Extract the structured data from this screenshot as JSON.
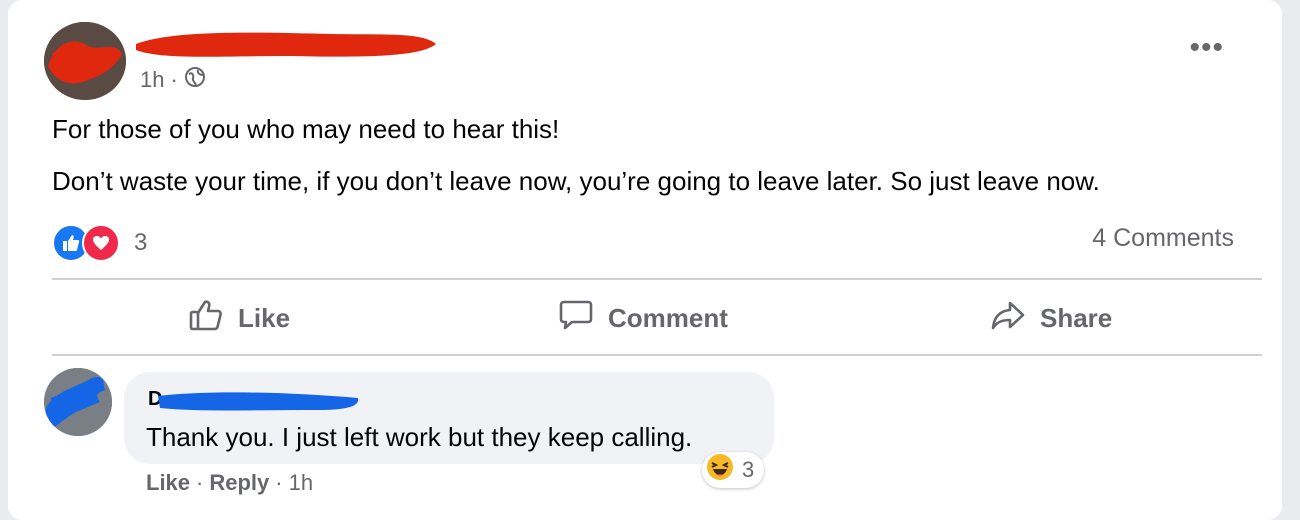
{
  "post": {
    "author_initial_visible": "",
    "time": "1h",
    "separator": "·",
    "audience_icon": "globe-icon",
    "more_icon": "•••",
    "lines": [
      "For those of you who may need to hear this!",
      "Don’t waste your time, if you don’t leave now, you’re going to leave later. So just leave now."
    ],
    "reaction_count": "3",
    "comments_label": "4 Comments"
  },
  "actions": {
    "like": "Like",
    "comment": "Comment",
    "share": "Share"
  },
  "comment": {
    "author_initial": "D",
    "text": "Thank you. I just left work but they keep calling.",
    "reaction_count": "3",
    "like": "Like",
    "reply": "Reply",
    "separator": "·",
    "time": "1h"
  },
  "colors": {
    "redact_red": "#e0280f",
    "redact_blue": "#1566e6",
    "like_blue": "#1877f2",
    "love_red": "#f02849",
    "muted_text": "#65676b"
  }
}
